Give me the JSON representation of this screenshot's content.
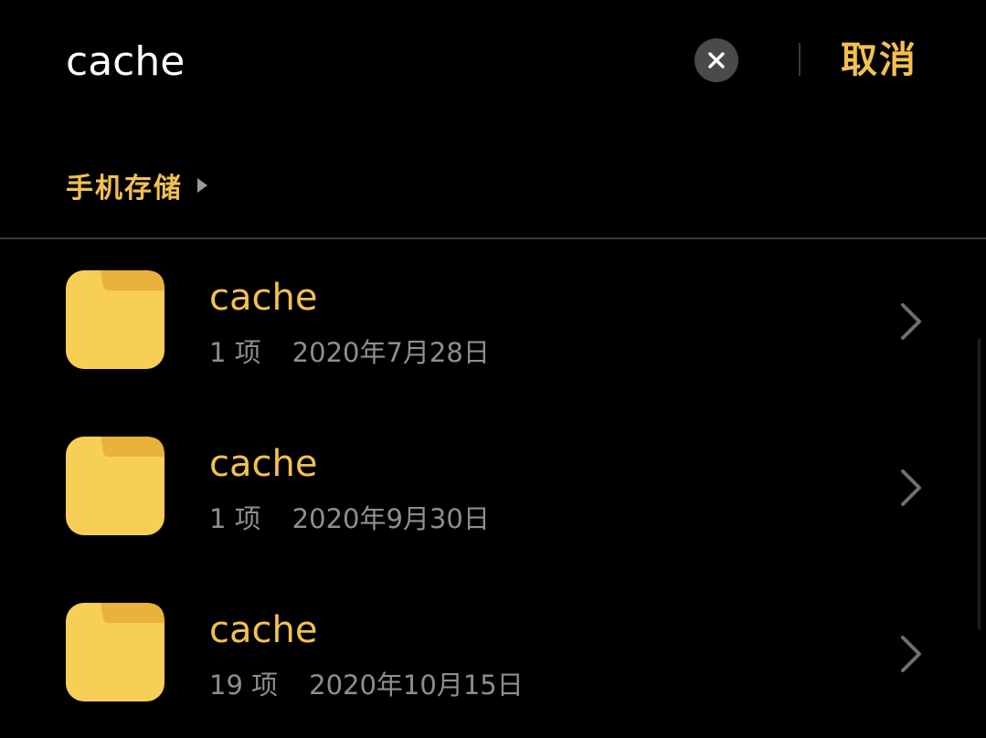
{
  "search": {
    "value": "cache",
    "cancel_label": "取消"
  },
  "breadcrumb": {
    "label": "手机存储"
  },
  "files": [
    {
      "name": "cache",
      "count": "1 项",
      "date": "2020年7月28日"
    },
    {
      "name": "cache",
      "count": "1 项",
      "date": "2020年9月30日"
    },
    {
      "name": "cache",
      "count": "19 项",
      "date": "2020年10月15日"
    }
  ],
  "colors": {
    "accent": "#f2c14e",
    "folder": "#f7cf57",
    "background": "#000000",
    "secondary_text": "#8e8e8e"
  },
  "icons": [
    "close-icon",
    "breadcrumb-arrow-icon",
    "folder-icon",
    "chevron-right-icon"
  ]
}
